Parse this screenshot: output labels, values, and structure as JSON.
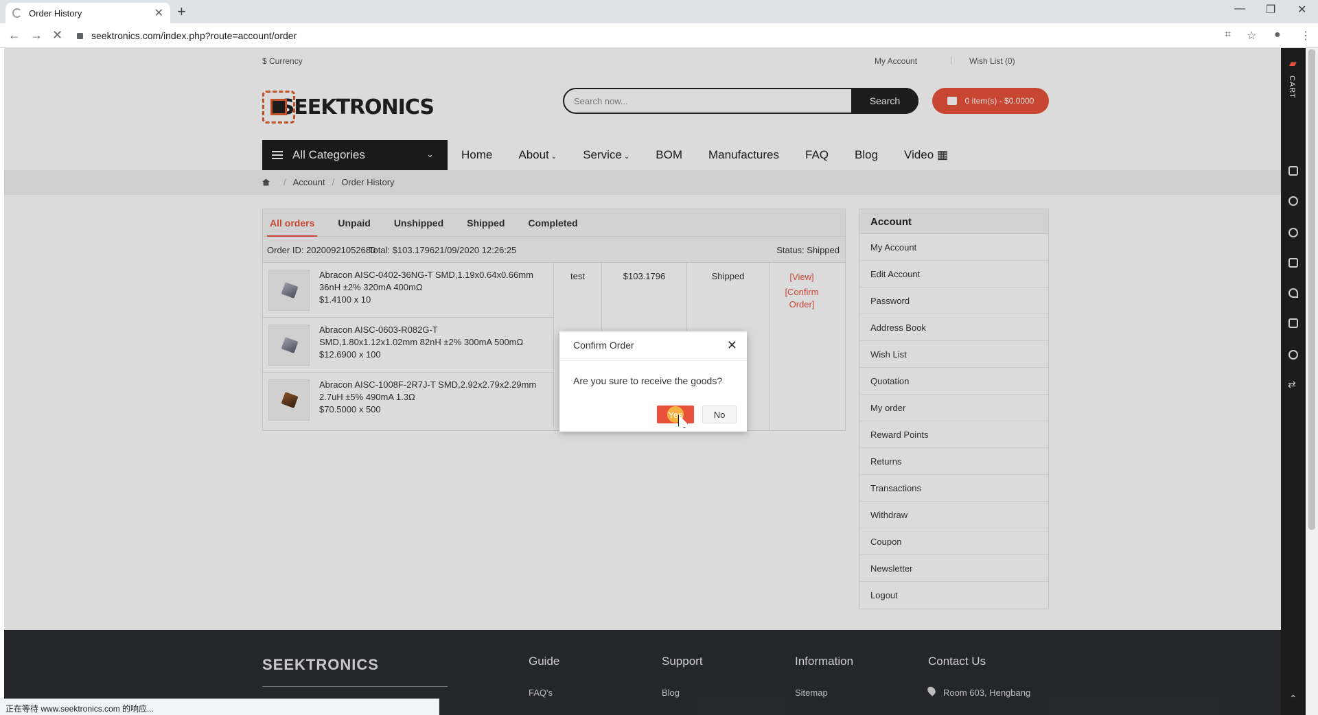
{
  "browser": {
    "tab_title": "Order History",
    "url": "seektronics.com/index.php?route=account/order",
    "status_text": "正在等待 www.seektronics.com 的响应..."
  },
  "topbar": {
    "currency": "$ Currency",
    "my_account": "My Account",
    "wish_list": "Wish List (0)"
  },
  "header": {
    "logo_text": "SEEKTRONICS",
    "search_placeholder": "Search now...",
    "search_button": "Search",
    "cart_label": "0 item(s) - $0.0000"
  },
  "nav": {
    "all_categories": "All Categories",
    "links": [
      "Home",
      "About",
      "Service",
      "BOM",
      "Manufactures",
      "FAQ",
      "Blog",
      "Video"
    ]
  },
  "breadcrumb": [
    "Account",
    "Order History"
  ],
  "orders": {
    "tabs": [
      "All orders",
      "Unpaid",
      "Unshipped",
      "Shipped",
      "Completed"
    ],
    "active_tab": "All orders",
    "order_id": "Order ID: 20200921052680",
    "total": "Total: $103.1796",
    "date": "21/09/2020 12:26:25",
    "status": "Status: Shipped",
    "items": [
      {
        "line1": "Abracon AISC-0402-36NG-T SMD,1.19x0.64x0.66mm",
        "line2": "36nH ±2% 320mA 400mΩ",
        "price": "$1.4100 x 10"
      },
      {
        "line1": "Abracon AISC-0603-R082G-T",
        "line2": "SMD,1.80x1.12x1.02mm 82nH ±2% 300mA 500mΩ",
        "price": "$12.6900 x 100"
      },
      {
        "line1": "Abracon AISC-1008F-2R7J-T SMD,2.92x2.79x2.29mm",
        "line2": "2.7uH ±5% 490mA 1.3Ω",
        "price": "$70.5000 x 500"
      }
    ],
    "remark": "test",
    "amount": "$103.1796",
    "order_status": "Shipped",
    "view_link": "[View]",
    "confirm_link_1": "[Confirm",
    "confirm_link_2": "Order]"
  },
  "sidebar": {
    "heading": "Account",
    "items": [
      "My Account",
      "Edit Account",
      "Password",
      "Address Book",
      "Wish List",
      "Quotation",
      "My order",
      "Reward Points",
      "Returns",
      "Transactions",
      "Withdraw",
      "Coupon",
      "Newsletter",
      "Logout"
    ]
  },
  "footer": {
    "brand": "SEEKTRONICS",
    "columns": [
      "Guide",
      "Support",
      "Information",
      "Contact Us"
    ],
    "links": [
      "FAQ's",
      "Blog",
      "Sitemap",
      "Room 603, Hengbang"
    ]
  },
  "right_bar": {
    "cart_label": "CART"
  },
  "modal": {
    "title": "Confirm Order",
    "message": "Are you sure to receive the goods?",
    "yes": "Yes",
    "no": "No"
  },
  "colors": {
    "accent": "#e8523a",
    "dark": "#1f1f1f",
    "footer_bg": "#2a2d33"
  }
}
